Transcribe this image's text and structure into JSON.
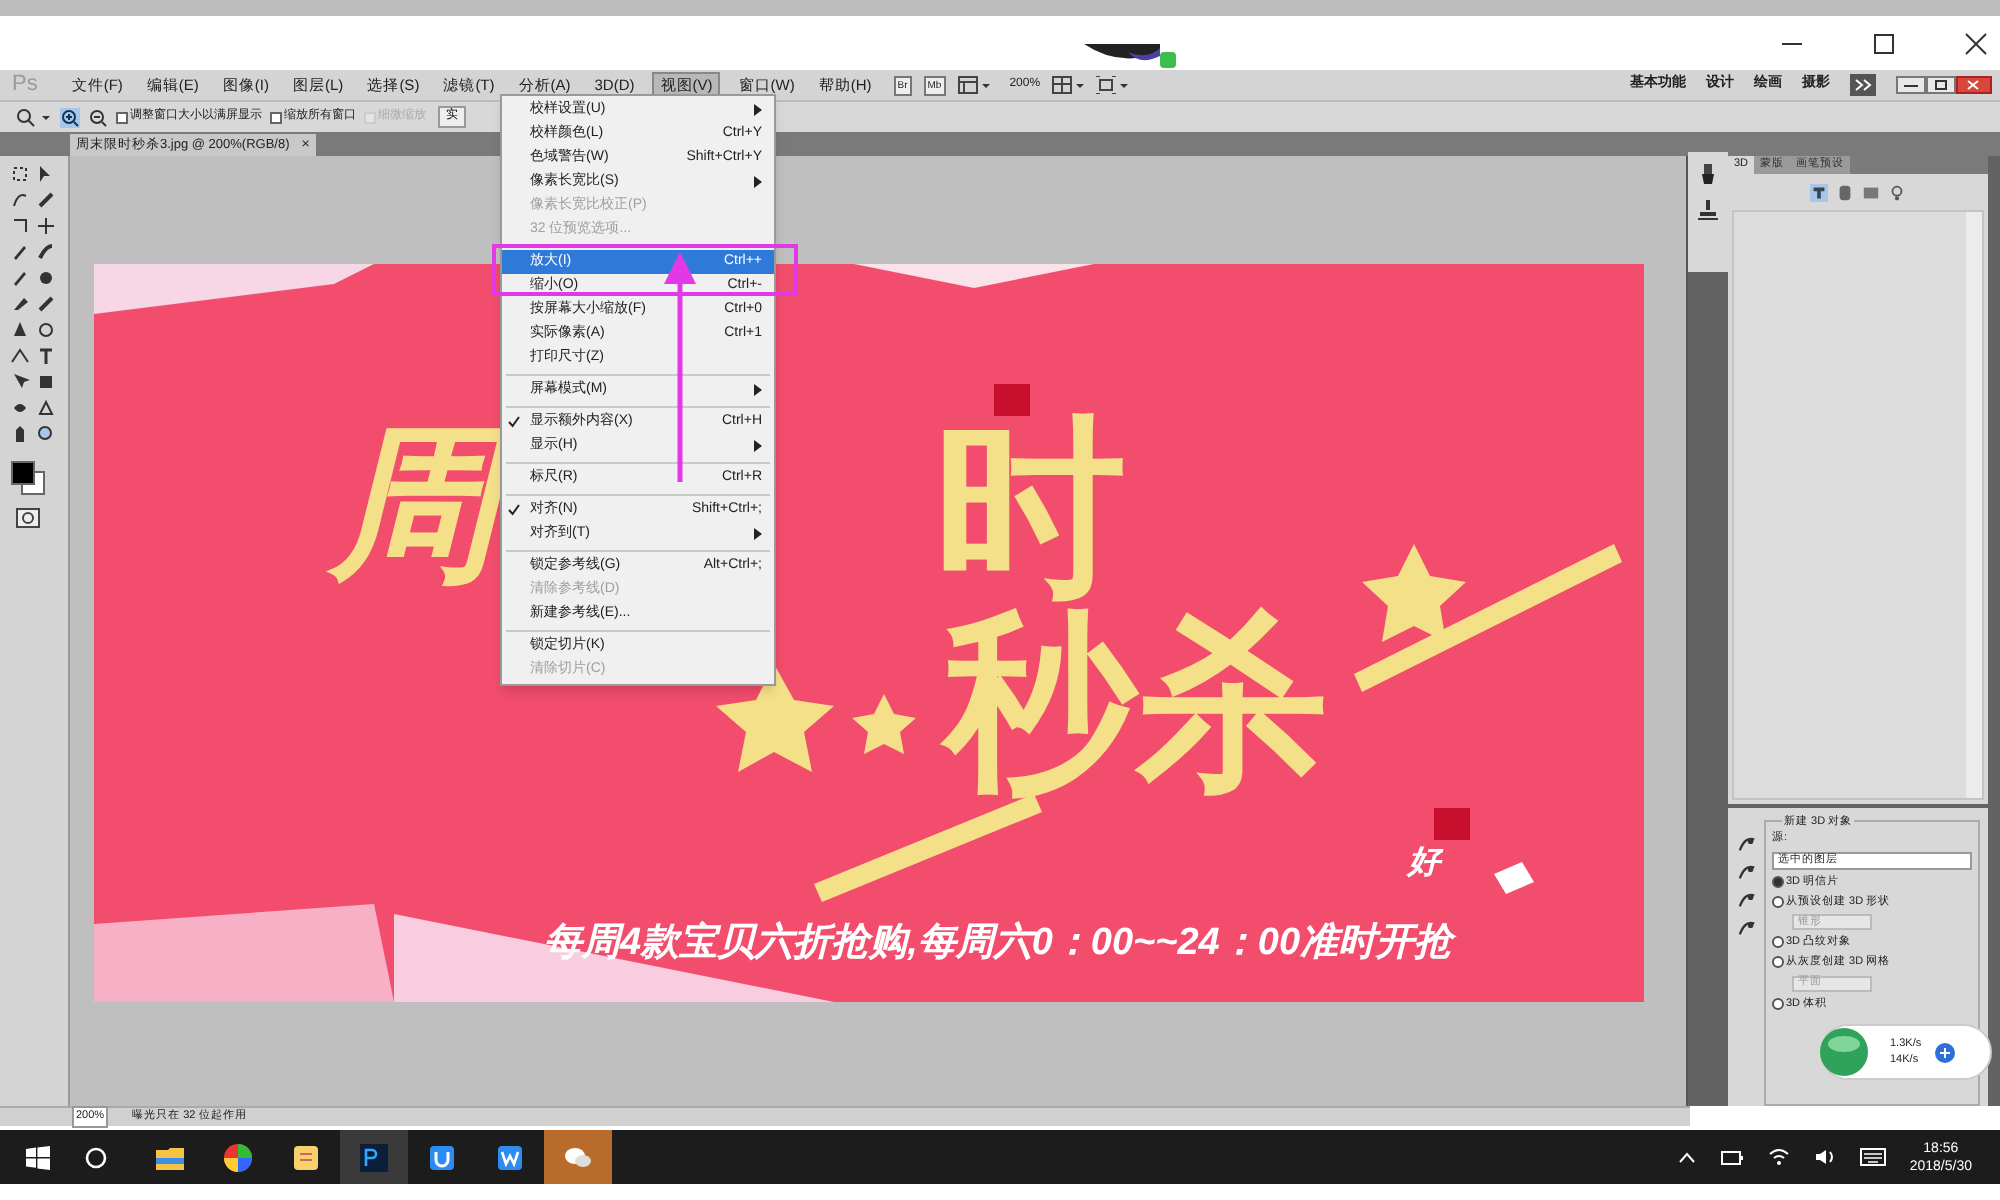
{
  "app": {
    "logo": "Ps",
    "menus": [
      {
        "label": "文件(F)",
        "selected": false
      },
      {
        "label": "编辑(E)",
        "selected": false
      },
      {
        "label": "图像(I)",
        "selected": false
      },
      {
        "label": "图层(L)",
        "selected": false
      },
      {
        "label": "选择(S)",
        "selected": false
      },
      {
        "label": "滤镜(T)",
        "selected": false
      },
      {
        "label": "分析(A)",
        "selected": false
      },
      {
        "label": "3D(D)",
        "selected": false
      },
      {
        "label": "视图(V)",
        "selected": true
      },
      {
        "label": "窗口(W)",
        "selected": false
      },
      {
        "label": "帮助(H)",
        "selected": false
      }
    ],
    "bridge_buttons": [
      "Br",
      "Mb"
    ],
    "zoom": "200%",
    "workspaces": [
      {
        "label": "基本功能",
        "selected": false
      },
      {
        "label": "设计",
        "selected": false
      },
      {
        "label": "绘画",
        "selected": false
      },
      {
        "label": "摄影",
        "selected": false
      }
    ]
  },
  "options_bar": {
    "checkboxes": [
      {
        "label": "调整窗口大小以满屏显示",
        "checked": false,
        "disabled": false
      },
      {
        "label": "缩放所有窗口",
        "checked": false,
        "disabled": false
      },
      {
        "label": "细微缩放",
        "checked": false,
        "disabled": true
      }
    ],
    "button": "实"
  },
  "document": {
    "tab": "周末限时秒杀3.jpg @ 200%(RGB/8)",
    "close": "×",
    "banner": {
      "title_parts": [
        "周",
        "时",
        "秒杀"
      ],
      "tag": "好",
      "subtitle": "每周4款宝贝六折抢购,每周六0：00~~24：00准时开抢"
    }
  },
  "view_menu": [
    {
      "kind": "item",
      "label": "校样设置(U)",
      "submenu": true,
      "disabled": false,
      "checked": false,
      "selected": false
    },
    {
      "kind": "item",
      "label": "校样颜色(L)",
      "shortcut": "Ctrl+Y",
      "submenu": false,
      "disabled": false,
      "checked": false,
      "selected": false
    },
    {
      "kind": "item",
      "label": "色域警告(W)",
      "shortcut": "Shift+Ctrl+Y",
      "submenu": false,
      "disabled": false,
      "checked": false,
      "selected": false
    },
    {
      "kind": "item",
      "label": "像素长宽比(S)",
      "submenu": true,
      "disabled": false,
      "checked": false,
      "selected": false
    },
    {
      "kind": "item",
      "label": "像素长宽比校正(P)",
      "submenu": false,
      "disabled": true,
      "checked": false,
      "selected": false
    },
    {
      "kind": "item",
      "label": "32 位预览选项...",
      "submenu": false,
      "disabled": true,
      "checked": false,
      "selected": false
    },
    {
      "kind": "separator"
    },
    {
      "kind": "item",
      "label": "放大(I)",
      "shortcut": "Ctrl++",
      "submenu": false,
      "disabled": false,
      "checked": false,
      "selected": true
    },
    {
      "kind": "item",
      "label": "缩小(O)",
      "shortcut": "Ctrl+-",
      "submenu": false,
      "disabled": false,
      "checked": false,
      "selected": false
    },
    {
      "kind": "item",
      "label": "按屏幕大小缩放(F)",
      "shortcut": "Ctrl+0",
      "submenu": false,
      "disabled": false,
      "checked": false,
      "selected": false
    },
    {
      "kind": "item",
      "label": "实际像素(A)",
      "shortcut": "Ctrl+1",
      "submenu": false,
      "disabled": false,
      "checked": false,
      "selected": false
    },
    {
      "kind": "item",
      "label": "打印尺寸(Z)",
      "submenu": false,
      "disabled": false,
      "checked": false,
      "selected": false
    },
    {
      "kind": "separator"
    },
    {
      "kind": "item",
      "label": "屏幕模式(M)",
      "submenu": true,
      "disabled": false,
      "checked": false,
      "selected": false
    },
    {
      "kind": "separator"
    },
    {
      "kind": "item",
      "label": "显示额外内容(X)",
      "shortcut": "Ctrl+H",
      "submenu": false,
      "disabled": false,
      "checked": true,
      "selected": false
    },
    {
      "kind": "item",
      "label": "显示(H)",
      "submenu": true,
      "disabled": false,
      "checked": false,
      "selected": false
    },
    {
      "kind": "separator"
    },
    {
      "kind": "item",
      "label": "标尺(R)",
      "shortcut": "Ctrl+R",
      "submenu": false,
      "disabled": false,
      "checked": false,
      "selected": false
    },
    {
      "kind": "separator"
    },
    {
      "kind": "item",
      "label": "对齐(N)",
      "shortcut": "Shift+Ctrl+;",
      "submenu": false,
      "disabled": false,
      "checked": true,
      "selected": false
    },
    {
      "kind": "item",
      "label": "对齐到(T)",
      "submenu": true,
      "disabled": false,
      "checked": false,
      "selected": false
    },
    {
      "kind": "separator"
    },
    {
      "kind": "item",
      "label": "锁定参考线(G)",
      "shortcut": "Alt+Ctrl+;",
      "submenu": false,
      "disabled": false,
      "checked": false,
      "selected": false
    },
    {
      "kind": "item",
      "label": "清除参考线(D)",
      "submenu": false,
      "disabled": true,
      "checked": false,
      "selected": false
    },
    {
      "kind": "item",
      "label": "新建参考线(E)...",
      "submenu": false,
      "disabled": false,
      "checked": false,
      "selected": false
    },
    {
      "kind": "separator"
    },
    {
      "kind": "item",
      "label": "锁定切片(K)",
      "submenu": false,
      "disabled": false,
      "checked": false,
      "selected": false
    },
    {
      "kind": "item",
      "label": "清除切片(C)",
      "submenu": false,
      "disabled": true,
      "checked": false,
      "selected": false
    }
  ],
  "panel_3d": {
    "tabs": [
      {
        "label": "3D",
        "selected": true
      },
      {
        "label": "蒙版",
        "selected": false
      },
      {
        "label": "画笔预设",
        "selected": false
      }
    ],
    "group_title": "新建 3D 对象",
    "source_label": "源:",
    "source_value": "选中的图层",
    "options": [
      {
        "kind": "radio",
        "label": "3D 明信片",
        "selected": true
      },
      {
        "kind": "radio",
        "label": "从预设创建 3D 形状",
        "selected": false
      },
      {
        "kind": "select",
        "value": "锥形"
      },
      {
        "kind": "radio",
        "label": "3D 凸纹对象",
        "selected": false
      },
      {
        "kind": "radio",
        "label": "从灰度创建 3D 网格",
        "selected": false
      },
      {
        "kind": "select",
        "value": "平面"
      },
      {
        "kind": "radio",
        "label": "3D 体积",
        "selected": false
      }
    ]
  },
  "net_widget": {
    "up": "1.3K/s",
    "down": "14K/s"
  },
  "status_bar": {
    "zoom": "200%",
    "message": "曝光只在 32 位起作用"
  },
  "taskbar": {
    "time": "18:56",
    "date": "2018/5/30"
  }
}
